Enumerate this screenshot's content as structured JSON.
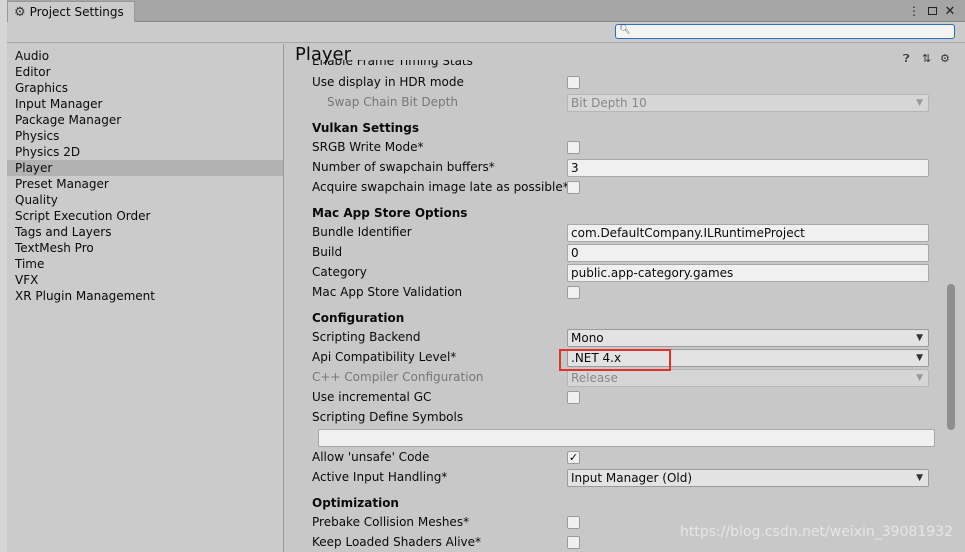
{
  "window": {
    "tab_title": "Project Settings",
    "menu_icon": "kebab-menu-icon",
    "maximize_icon": "maximize-icon",
    "close_icon": "close-icon",
    "search_placeholder": ""
  },
  "sidebar": {
    "items": [
      {
        "label": "Audio",
        "selected": false
      },
      {
        "label": "Editor",
        "selected": false
      },
      {
        "label": "Graphics",
        "selected": false
      },
      {
        "label": "Input Manager",
        "selected": false
      },
      {
        "label": "Package Manager",
        "selected": false
      },
      {
        "label": "Physics",
        "selected": false
      },
      {
        "label": "Physics 2D",
        "selected": false
      },
      {
        "label": "Player",
        "selected": true
      },
      {
        "label": "Preset Manager",
        "selected": false
      },
      {
        "label": "Quality",
        "selected": false
      },
      {
        "label": "Script Execution Order",
        "selected": false
      },
      {
        "label": "Tags and Layers",
        "selected": false
      },
      {
        "label": "TextMesh Pro",
        "selected": false
      },
      {
        "label": "Time",
        "selected": false
      },
      {
        "label": "VFX",
        "selected": false
      },
      {
        "label": "XR Plugin Management",
        "selected": false
      }
    ]
  },
  "main": {
    "title": "Player",
    "rows": {
      "hdr_display": {
        "label": "Use display in HDR mode",
        "checked": false
      },
      "swap_chain": {
        "label": "Swap Chain Bit Depth",
        "value": "Bit Depth 10"
      },
      "vulkan_section": "Vulkan Settings",
      "srgb": {
        "label": "SRGB Write Mode*",
        "checked": false
      },
      "swapchain_buffers": {
        "label": "Number of swapchain buffers*",
        "value": "3"
      },
      "acquire_late": {
        "label": "Acquire swapchain image late as possible*",
        "checked": false
      },
      "mac_section": "Mac App Store Options",
      "bundle_id": {
        "label": "Bundle Identifier",
        "value": "com.DefaultCompany.ILRuntimeProject"
      },
      "build": {
        "label": "Build",
        "value": "0"
      },
      "category": {
        "label": "Category",
        "value": "public.app-category.games"
      },
      "mac_validation": {
        "label": "Mac App Store Validation",
        "checked": false
      },
      "config_section": "Configuration",
      "scripting_backend": {
        "label": "Scripting Backend",
        "value": "Mono"
      },
      "api_level": {
        "label": "Api Compatibility Level*",
        "value": ".NET 4.x"
      },
      "cpp_config": {
        "label": "C++ Compiler Configuration",
        "value": "Release"
      },
      "incremental_gc": {
        "label": "Use incremental GC",
        "checked": false
      },
      "define_symbols": {
        "label": "Scripting Define Symbols",
        "value": ""
      },
      "unsafe_code": {
        "label": "Allow 'unsafe' Code",
        "checked": true
      },
      "input_handling": {
        "label": "Active Input Handling*",
        "value": "Input Manager (Old)"
      },
      "opt_section": "Optimization",
      "prebake": {
        "label": "Prebake Collision Meshes*",
        "checked": false
      },
      "keep_shaders": {
        "label": "Keep Loaded Shaders Alive*",
        "checked": false
      }
    }
  },
  "colors": {
    "highlight": "#e0312b",
    "selected_item": "#b2b2b2"
  },
  "watermark": "https://blog.csdn.net/weixin_39081932"
}
